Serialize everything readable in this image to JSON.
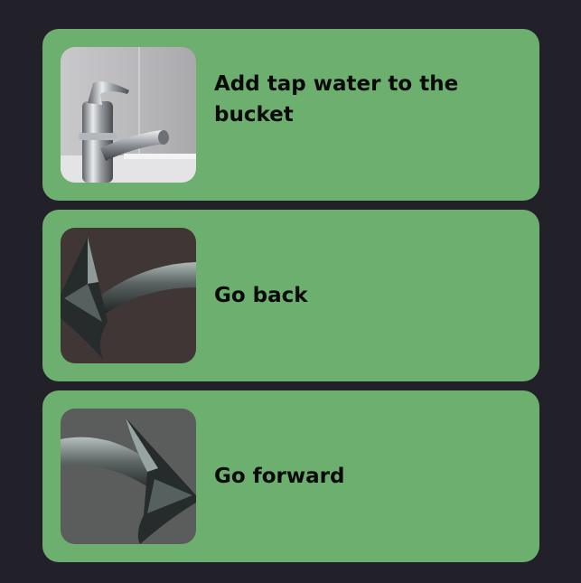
{
  "cards": [
    {
      "label": "Add tap water to the bucket",
      "icon": "faucet-icon"
    },
    {
      "label": "Go back",
      "icon": "arrow-back-icon"
    },
    {
      "label": "Go forward",
      "icon": "arrow-forward-icon"
    }
  ],
  "colors": {
    "background": "#22212a",
    "card": "#6daf6f",
    "text": "#0a0a0a"
  }
}
